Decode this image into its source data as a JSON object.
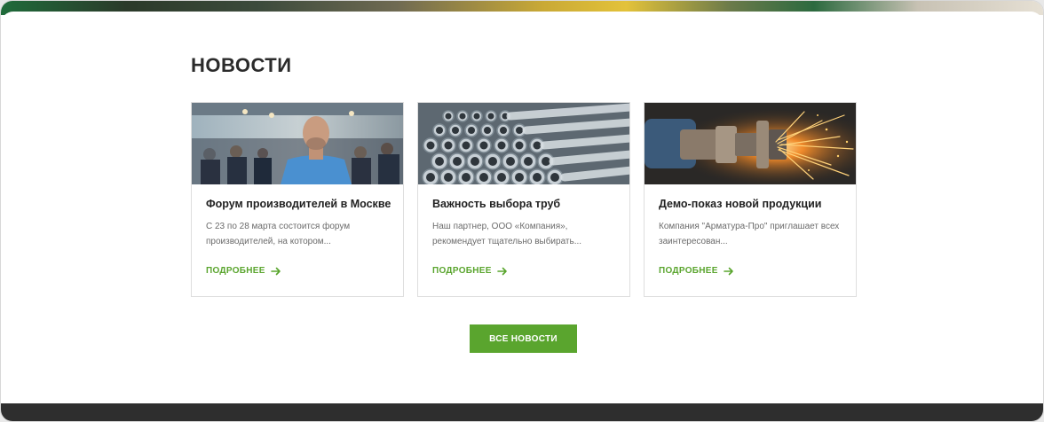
{
  "section": {
    "title": "НОВОСТИ"
  },
  "news": [
    {
      "title": "Форум производителей в Москве",
      "text": "С 23 по 28 марта состоится форум производителей, на котором...",
      "more_label": "ПОДРОБНЕЕ",
      "image_icon": "conference-person-photo"
    },
    {
      "title": "Важность выбора труб",
      "text": "Наш партнер, ООО «Компания», рекомендует тщательно выбирать...",
      "more_label": "ПОДРОБНЕЕ",
      "image_icon": "steel-pipes-photo"
    },
    {
      "title": "Демо-показ новой продукции",
      "text": "Компания \"Арматура-Про\" приглашает всех заинтересован...",
      "more_label": "ПОДРОБНЕЕ",
      "image_icon": "grinding-sparks-photo"
    }
  ],
  "all_news_button": {
    "label": "ВСЕ НОВОСТИ"
  },
  "colors": {
    "accent": "#5aa52e",
    "title": "#2b2b2b",
    "text": "#6b6b6b",
    "footer": "#2e2e2e"
  }
}
